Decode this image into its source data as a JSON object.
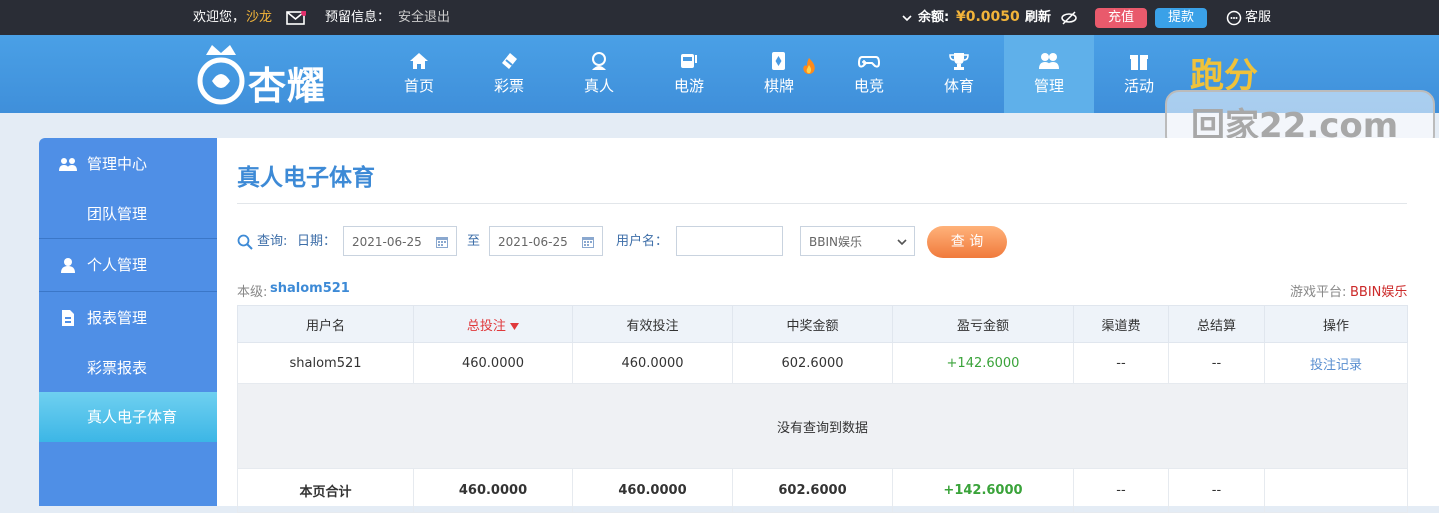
{
  "topbar": {
    "welcome": "欢迎您，",
    "username": "沙龙",
    "reserved_info": "预留信息：",
    "logout": "安全退出",
    "balance_label": "余额:",
    "balance_value": "¥0.0050",
    "refresh": "刷新",
    "recharge": "充值",
    "withdraw": "提款",
    "service": "客服"
  },
  "brand": {
    "logo_text": "杏耀"
  },
  "nav": [
    {
      "label": "首页",
      "icon": "home-icon"
    },
    {
      "label": "彩票",
      "icon": "lottery-icon"
    },
    {
      "label": "真人",
      "icon": "live-icon"
    },
    {
      "label": "电游",
      "icon": "slot-icon"
    },
    {
      "label": "棋牌",
      "icon": "cards-icon"
    },
    {
      "label": "电竞",
      "icon": "gamepad-icon"
    },
    {
      "label": "体育",
      "icon": "trophy-icon"
    },
    {
      "label": "管理",
      "icon": "users-icon"
    },
    {
      "label": "活动",
      "icon": "gift-icon"
    }
  ],
  "watermark": {
    "line1": "跑分",
    "line2": "回家22.com"
  },
  "sidebar": {
    "items": [
      {
        "label": "管理中心",
        "icon": "users-icon"
      },
      {
        "label": "团队管理"
      },
      {
        "label": "个人管理",
        "icon": "user-icon"
      },
      {
        "label": "报表管理",
        "icon": "report-icon"
      },
      {
        "label": "彩票报表"
      },
      {
        "label": "真人电子体育"
      }
    ]
  },
  "page": {
    "title": "真人电子体育",
    "query_label": "查询:",
    "date_label": "日期：",
    "date_from": "2021-06-25",
    "to": "至",
    "date_to": "2021-06-25",
    "username_label": "用户名：",
    "username_value": "",
    "platform_select": "BBIN娱乐",
    "search_button": "查 询",
    "level_label": "本级:",
    "level_value": "shalom521",
    "platform_label": "游戏平台:",
    "platform_value": "BBIN娱乐"
  },
  "table": {
    "headers": [
      "用户名",
      "总投注",
      "有效投注",
      "中奖金额",
      "盈亏金额",
      "渠道费",
      "总结算",
      "操作"
    ],
    "row": [
      "shalom521",
      "460.0000",
      "460.0000",
      "602.6000",
      "+142.6000",
      "--",
      "--",
      "投注记录"
    ],
    "empty_text": "没有查询到数据",
    "total": [
      "本页合计",
      "460.0000",
      "460.0000",
      "602.6000",
      "+142.6000",
      "--",
      "--",
      ""
    ]
  }
}
